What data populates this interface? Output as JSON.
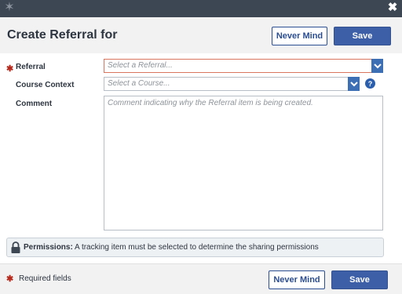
{
  "window": {
    "close_glyph": "✖",
    "logo_icon": "app-logo-icon"
  },
  "header": {
    "title": "Create Referral for",
    "never_mind_label": "Never Mind",
    "save_label": "Save"
  },
  "form": {
    "referral": {
      "label": "Referral",
      "placeholder": "Select a Referral...",
      "required": true
    },
    "course_context": {
      "label": "Course Context",
      "placeholder": "Select a Course...",
      "help": "?"
    },
    "comment": {
      "label": "Comment",
      "placeholder": "Comment indicating why the Referral item is being created."
    }
  },
  "permissions": {
    "title": "Permissions:",
    "message": "A tracking item must be selected to determine the sharing permissions"
  },
  "footer": {
    "required_star": "✱",
    "required_text": "Required fields",
    "never_mind_label": "Never Mind",
    "save_label": "Save"
  },
  "colors": {
    "titlebar": "#3d4753",
    "primary": "#3c5fa8",
    "required": "#b5281c",
    "error_border": "#d9745f"
  }
}
